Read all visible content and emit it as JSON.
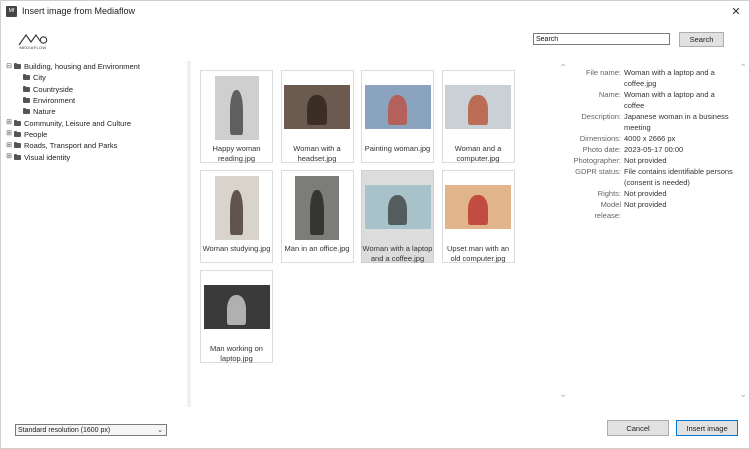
{
  "window": {
    "title": "Insert image from Mediaflow",
    "app_icon": "Mf",
    "close_glyph": "✕"
  },
  "logo": {
    "text": "MEDIAFLOW"
  },
  "search": {
    "value": "Search",
    "button": "Search"
  },
  "tree": {
    "items": [
      {
        "label": "Building, housing and Environment",
        "level": 0,
        "toggle": "⊟"
      },
      {
        "label": "City",
        "level": 1,
        "toggle": ""
      },
      {
        "label": "Countryside",
        "level": 1,
        "toggle": ""
      },
      {
        "label": "Environment",
        "level": 1,
        "toggle": ""
      },
      {
        "label": "Nature",
        "level": 1,
        "toggle": ""
      },
      {
        "label": "Community, Leisure and Culture",
        "level": 0,
        "toggle": "⊞"
      },
      {
        "label": "People",
        "level": 0,
        "toggle": "⊞"
      },
      {
        "label": "Roads, Transport and Parks",
        "level": 0,
        "toggle": "⊞"
      },
      {
        "label": "Visual identity",
        "level": 0,
        "toggle": "⊞"
      }
    ]
  },
  "thumbs": [
    {
      "caption1": "Happy woman",
      "caption2": "reading.jpg",
      "bg": "#cfcfcf",
      "fg": "#3a3a3a",
      "shape": "portrait"
    },
    {
      "caption1": "Woman with a",
      "caption2": "headset.jpg",
      "bg": "#6b5a4f",
      "fg": "#2a201a",
      "shape": "landscape"
    },
    {
      "caption1": "Painting woman.jpg",
      "caption2": "",
      "bg": "#8aa4c0",
      "fg": "#c24a3a",
      "shape": "landscape"
    },
    {
      "caption1": "Woman and a",
      "caption2": "computer.jpg",
      "bg": "#c9d1d6",
      "fg": "#b44a2a",
      "shape": "landscape"
    },
    {
      "caption1": "Woman studying.jpg",
      "caption2": "",
      "bg": "#d8d4cc",
      "fg": "#3a2a22",
      "shape": "portrait"
    },
    {
      "caption1": "Man in an office.jpg",
      "caption2": "",
      "bg": "#7c7c78",
      "fg": "#1e1e1e",
      "shape": "portrait"
    },
    {
      "caption1": "Woman with a laptop",
      "caption2": "and a coffee.jpg",
      "bg": "#a7c2c8",
      "fg": "#3a3a3a",
      "shape": "landscape"
    },
    {
      "caption1": "Upset man with an",
      "caption2": "old computer.jpg",
      "bg": "#e2b48c",
      "fg": "#b82a2a",
      "shape": "landscape"
    },
    {
      "caption1": "Man working on",
      "caption2": "laptop.jpg",
      "bg": "#3a3a3a",
      "fg": "#d8d8d8",
      "shape": "landscape"
    }
  ],
  "selected_index": 6,
  "details": [
    {
      "label": "File name:",
      "value": "Woman with a laptop and a coffee.jpg"
    },
    {
      "label": "Name:",
      "value": "Woman with a laptop and a coffee"
    },
    {
      "label": "Description:",
      "value": "Japanese woman in a business meeting"
    },
    {
      "label": "Dimensions:",
      "value": "4000 x 2666 px"
    },
    {
      "label": "Photo date:",
      "value": "2023-05-17 00:00"
    },
    {
      "label": "Photographer:",
      "value": "Not provided"
    },
    {
      "label": "GDPR status:",
      "value": "File contains identifiable persons (consent is needed)"
    },
    {
      "label": "Rights:",
      "value": "Not provided"
    },
    {
      "label": "Model release:",
      "value": "Not provided"
    }
  ],
  "resolution": {
    "selected": "Standard resolution (1600 px)"
  },
  "buttons": {
    "cancel": "Cancel",
    "insert": "Insert image"
  },
  "icons": {
    "scroll_up": "⌃",
    "scroll_down": "⌄",
    "dropdown": "⌄"
  }
}
